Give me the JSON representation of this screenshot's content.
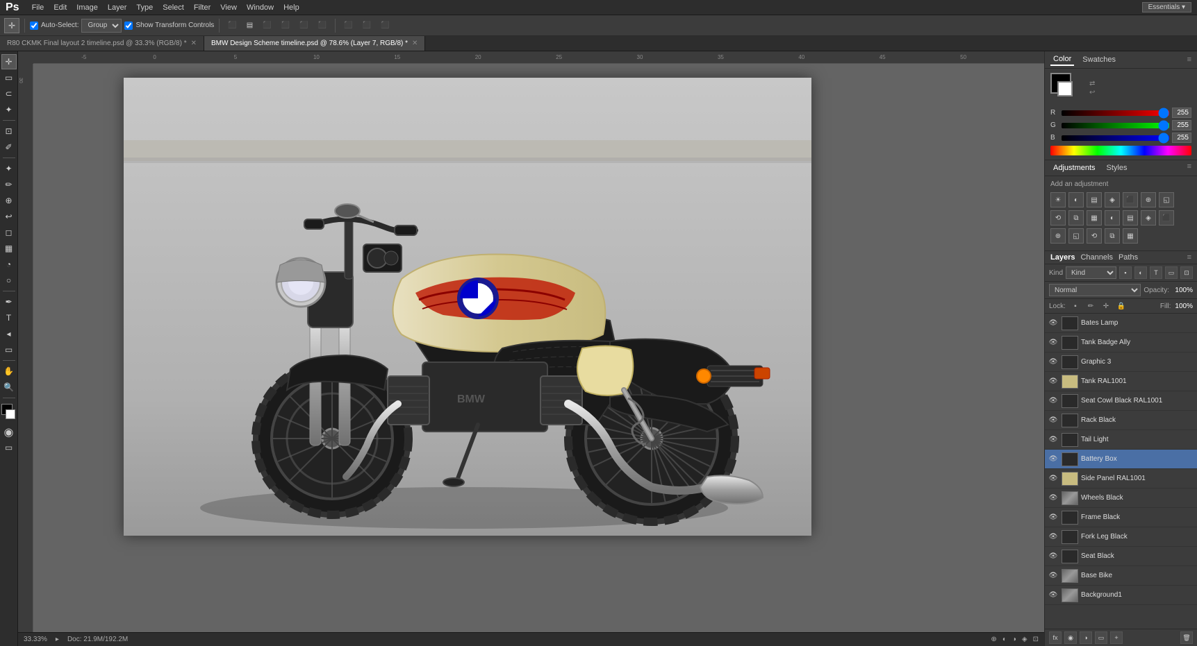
{
  "app": {
    "logo": "Ps",
    "menu_items": [
      "File",
      "Edit",
      "Image",
      "Layer",
      "Type",
      "Select",
      "Filter",
      "View",
      "Window",
      "Help"
    ]
  },
  "toolbar": {
    "auto_select_label": "Auto-Select:",
    "group_select": "Group",
    "show_transform": "Show Transform Controls",
    "align_buttons": [
      "align-left",
      "align-center",
      "align-right",
      "align-top",
      "align-middle",
      "align-bottom"
    ]
  },
  "tabs": [
    {
      "id": "tab1",
      "label": "R80 CKMK Final layout 2 timeline.psd @ 33.3% (RGB/8) *",
      "active": false
    },
    {
      "id": "tab2",
      "label": "BMW Design Scheme timeline.psd @ 78.6% (Layer 7, RGB/8) *",
      "active": true
    }
  ],
  "color_panel": {
    "tabs": [
      "Color",
      "Swatches"
    ],
    "active_tab": "Color",
    "r_label": "R",
    "g_label": "G",
    "b_label": "B",
    "r_value": "255",
    "g_value": "255",
    "b_value": "255"
  },
  "adjustments_panel": {
    "tabs": [
      "Adjustments",
      "Styles"
    ],
    "active_tab": "Adjustments",
    "add_label": "Add an adjustment",
    "icons": [
      "☀",
      "◐",
      "▤",
      "◈",
      "⬛",
      "⊕",
      "◱",
      "⟲",
      "⧉",
      "▦"
    ]
  },
  "layers_panel": {
    "title": "Layers",
    "tabs": [
      "Layers",
      "Channels",
      "Paths"
    ],
    "active_tab": "Layers",
    "kind_label": "Kind",
    "blend_mode": "Normal",
    "opacity_label": "Opacity:",
    "opacity_value": "100%",
    "fill_label": "Fill:",
    "fill_value": "100%",
    "lock_label": "Lock:",
    "layers": [
      {
        "id": 1,
        "name": "Bates Lamp",
        "visible": true,
        "thumb_type": "dark",
        "selected": false
      },
      {
        "id": 2,
        "name": "Tank Badge Ally",
        "visible": true,
        "thumb_type": "dark",
        "selected": false
      },
      {
        "id": 3,
        "name": "Graphic 3",
        "visible": true,
        "thumb_type": "dark",
        "selected": false
      },
      {
        "id": 4,
        "name": "Tank RAL1001",
        "visible": true,
        "thumb_type": "light",
        "selected": false
      },
      {
        "id": 5,
        "name": "Seat Cowl Black RAL1001",
        "visible": true,
        "thumb_type": "dark",
        "selected": false
      },
      {
        "id": 6,
        "name": "Rack Black",
        "visible": true,
        "thumb_type": "dark",
        "selected": false
      },
      {
        "id": 7,
        "name": "Tail Light",
        "visible": true,
        "thumb_type": "dark",
        "selected": false
      },
      {
        "id": 8,
        "name": "Battery Box",
        "visible": true,
        "thumb_type": "dark",
        "selected": true
      },
      {
        "id": 9,
        "name": "Side Panel RAL1001",
        "visible": true,
        "thumb_type": "light",
        "selected": false
      },
      {
        "id": 10,
        "name": "Wheels Black",
        "visible": true,
        "thumb_type": "photo",
        "selected": false
      },
      {
        "id": 11,
        "name": "Frame Black",
        "visible": true,
        "thumb_type": "dark",
        "selected": false
      },
      {
        "id": 12,
        "name": "Fork Leg Black",
        "visible": true,
        "thumb_type": "dark",
        "selected": false
      },
      {
        "id": 13,
        "name": "Seat Black",
        "visible": true,
        "thumb_type": "dark",
        "selected": false
      },
      {
        "id": 14,
        "name": "Base Bike",
        "visible": true,
        "thumb_type": "photo",
        "selected": false
      },
      {
        "id": 15,
        "name": "Background1",
        "visible": true,
        "thumb_type": "photo",
        "selected": false
      }
    ]
  },
  "status_bar": {
    "zoom": "33.33%",
    "doc_size": "Doc: 21.9M/192.2M"
  },
  "canvas": {
    "bg_color": "#646464"
  }
}
